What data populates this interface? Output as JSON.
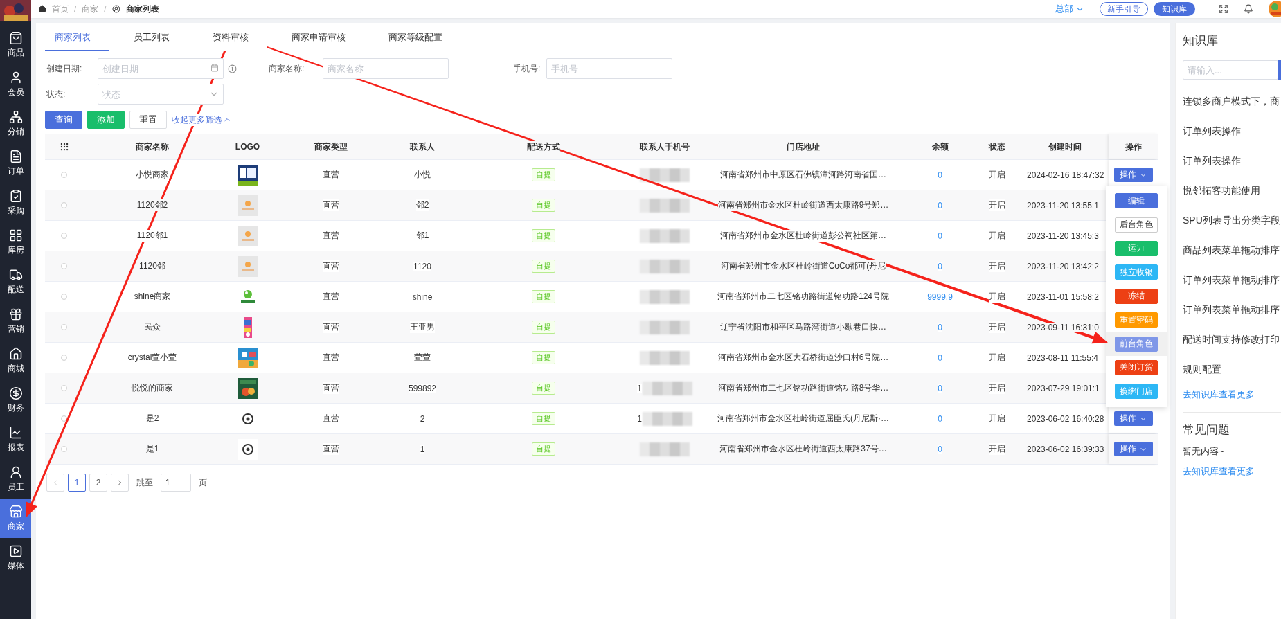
{
  "sidebar": {
    "items": [
      {
        "label": "商品",
        "selected": false
      },
      {
        "label": "会员",
        "selected": false
      },
      {
        "label": "分销",
        "selected": false
      },
      {
        "label": "订单",
        "selected": false
      },
      {
        "label": "采购",
        "selected": false
      },
      {
        "label": "库房",
        "selected": false
      },
      {
        "label": "配送",
        "selected": false
      },
      {
        "label": "营销",
        "selected": false
      },
      {
        "label": "商城",
        "selected": false
      },
      {
        "label": "财务",
        "selected": false
      },
      {
        "label": "报表",
        "selected": false
      },
      {
        "label": "员工",
        "selected": false
      },
      {
        "label": "商家",
        "selected": true
      },
      {
        "label": "媒体",
        "selected": false
      }
    ]
  },
  "topbar": {
    "breadcrumb": [
      "首页",
      "商家",
      "商家列表"
    ],
    "separator": "/",
    "org": "总部",
    "guide_button": "新手引导",
    "kb_button": "知识库"
  },
  "tabs": [
    {
      "label": "商家列表",
      "selected": true
    },
    {
      "label": "员工列表",
      "selected": false
    },
    {
      "label": "资料审核",
      "selected": false
    },
    {
      "label": "商家申请审核",
      "selected": false
    },
    {
      "label": "商家等级配置",
      "selected": false
    }
  ],
  "filters": [
    {
      "kind": "date",
      "label": "创建日期:",
      "placeholder": "创建日期"
    },
    {
      "kind": "text",
      "label": "商家名称:",
      "placeholder": "商家名称"
    },
    {
      "kind": "text",
      "label": "手机号:",
      "placeholder": "手机号"
    },
    {
      "kind": "select",
      "label": "状态:",
      "placeholder": "状态"
    }
  ],
  "actions": {
    "query": "查询",
    "add": "添加",
    "reset": "重置",
    "collapse": "收起更多筛选"
  },
  "table": {
    "columns": [
      "商家名称",
      "LOGO",
      "商家类型",
      "联系人",
      "配送方式",
      "联系人手机号",
      "门店地址",
      "余额",
      "状态",
      "创建时间",
      "操作"
    ],
    "rows": [
      {
        "selected": false,
        "name": "小悦商家",
        "type": "直营",
        "contact": "小悦",
        "delivery": "自提",
        "address": "河南省郑州市中原区石佛镇漳河路河南省国…",
        "balance": "0",
        "status": "开启",
        "created": "2024-02-16 18:47:32",
        "action": "操作"
      },
      {
        "selected": false,
        "name": "1120邻2",
        "type": "直营",
        "contact": "邻2",
        "delivery": "自提",
        "address": "河南省郑州市金水区杜岭街道西太康路9号郑…",
        "balance": "0",
        "status": "开启",
        "created": "2023-11-20 13:55:1"
      },
      {
        "selected": false,
        "name": "1120邻1",
        "type": "直营",
        "contact": "邻1",
        "delivery": "自提",
        "address": "河南省郑州市金水区杜岭街道彭公祠社区第…",
        "balance": "0",
        "status": "开启",
        "created": "2023-11-20 13:45:3"
      },
      {
        "selected": false,
        "name": "1120邻",
        "type": "直营",
        "contact": "1120",
        "delivery": "自提",
        "address": "河南省郑州市金水区杜岭街道CoCo都可(丹尼",
        "balance": "0",
        "status": "开启",
        "created": "2023-11-20 13:42:2"
      },
      {
        "selected": false,
        "name": "shine商家",
        "type": "直营",
        "contact": "shine",
        "delivery": "自提",
        "address": "河南省郑州市二七区铭功路街道铭功路124号院",
        "balance": "9999.9",
        "status": "开启",
        "created": "2023-11-01 15:58:2"
      },
      {
        "selected": false,
        "name": "民众",
        "type": "直营",
        "contact": "王亚男",
        "delivery": "自提",
        "address": "辽宁省沈阳市和平区马路湾街道小歇巷口快…",
        "balance": "0",
        "status": "开启",
        "created": "2023-09-11 16:31:0"
      },
      {
        "selected": false,
        "name": "crystal萱小萱",
        "type": "直营",
        "contact": "萱萱",
        "delivery": "自提",
        "address": "河南省郑州市金水区大石桥街道沙口村6号院…",
        "balance": "0",
        "status": "开启",
        "created": "2023-08-11 11:55:4"
      },
      {
        "selected": false,
        "name": "悦悦的商家",
        "type": "直营",
        "contact": "599892",
        "delivery": "自提",
        "phone_prefix": "1",
        "address": "河南省郑州市二七区铭功路街道铭功路8号华…",
        "balance": "0",
        "status": "开启",
        "created": "2023-07-29 19:01:1"
      },
      {
        "selected": false,
        "name": "是2",
        "type": "直营",
        "contact": "2",
        "delivery": "自提",
        "phone_prefix": "1",
        "address": "河南省郑州市金水区杜岭街道屈臣氏(丹尼斯·…",
        "balance": "0",
        "status": "开启",
        "created": "2023-06-02 16:40:28",
        "action": "操作"
      },
      {
        "selected": false,
        "name": "是1",
        "type": "直营",
        "contact": "1",
        "delivery": "自提",
        "address": "河南省郑州市金水区杜岭街道西太康路37号…",
        "balance": "0",
        "status": "开启",
        "created": "2023-06-02 16:39:33",
        "action": "操作"
      }
    ]
  },
  "action_menu": {
    "items": [
      {
        "label": "编辑",
        "kind": "filled",
        "color": "#4a6fdc",
        "hovered": false
      },
      {
        "label": "后台角色",
        "kind": "outline",
        "color": "#ffffff",
        "hovered": false
      },
      {
        "label": "运力",
        "kind": "filled",
        "color": "#19be6b",
        "hovered": false
      },
      {
        "label": "独立收银",
        "kind": "filled",
        "color": "#2db7f5",
        "hovered": false
      },
      {
        "label": "冻结",
        "kind": "filled",
        "color": "#ed4014",
        "hovered": false
      },
      {
        "label": "重置密码",
        "kind": "filled",
        "color": "#ff9900",
        "hovered": false
      },
      {
        "label": "前台角色",
        "kind": "filled",
        "color": "#7f97e8",
        "hovered": true
      },
      {
        "label": "关闭订货",
        "kind": "filled",
        "color": "#ed4014",
        "hovered": false
      },
      {
        "label": "换绑门店",
        "kind": "filled",
        "color": "#2db7f5",
        "hovered": false
      }
    ]
  },
  "pagination": {
    "pages": [
      {
        "label": "1",
        "selected": true
      },
      {
        "label": "2",
        "selected": false
      }
    ],
    "jump_label": "跳至",
    "jump_value": "1",
    "page_suffix": "页"
  },
  "knowledge": {
    "title": "知识库",
    "search_placeholder": "请输入...",
    "articles": [
      "连锁多商户模式下，商",
      "订单列表操作",
      "订单列表操作",
      "悦邻拓客功能使用",
      "SPU列表导出分类字段",
      "商品列表菜单拖动排序",
      "订单列表菜单拖动排序",
      "订单列表菜单拖动排序",
      "配送时间支持修改打印",
      "规则配置"
    ],
    "more_link": "去知识库查看更多",
    "faq_title": "常见问题",
    "faq_empty": "暂无内容~",
    "faq_more_link": "去知识库查看更多"
  }
}
